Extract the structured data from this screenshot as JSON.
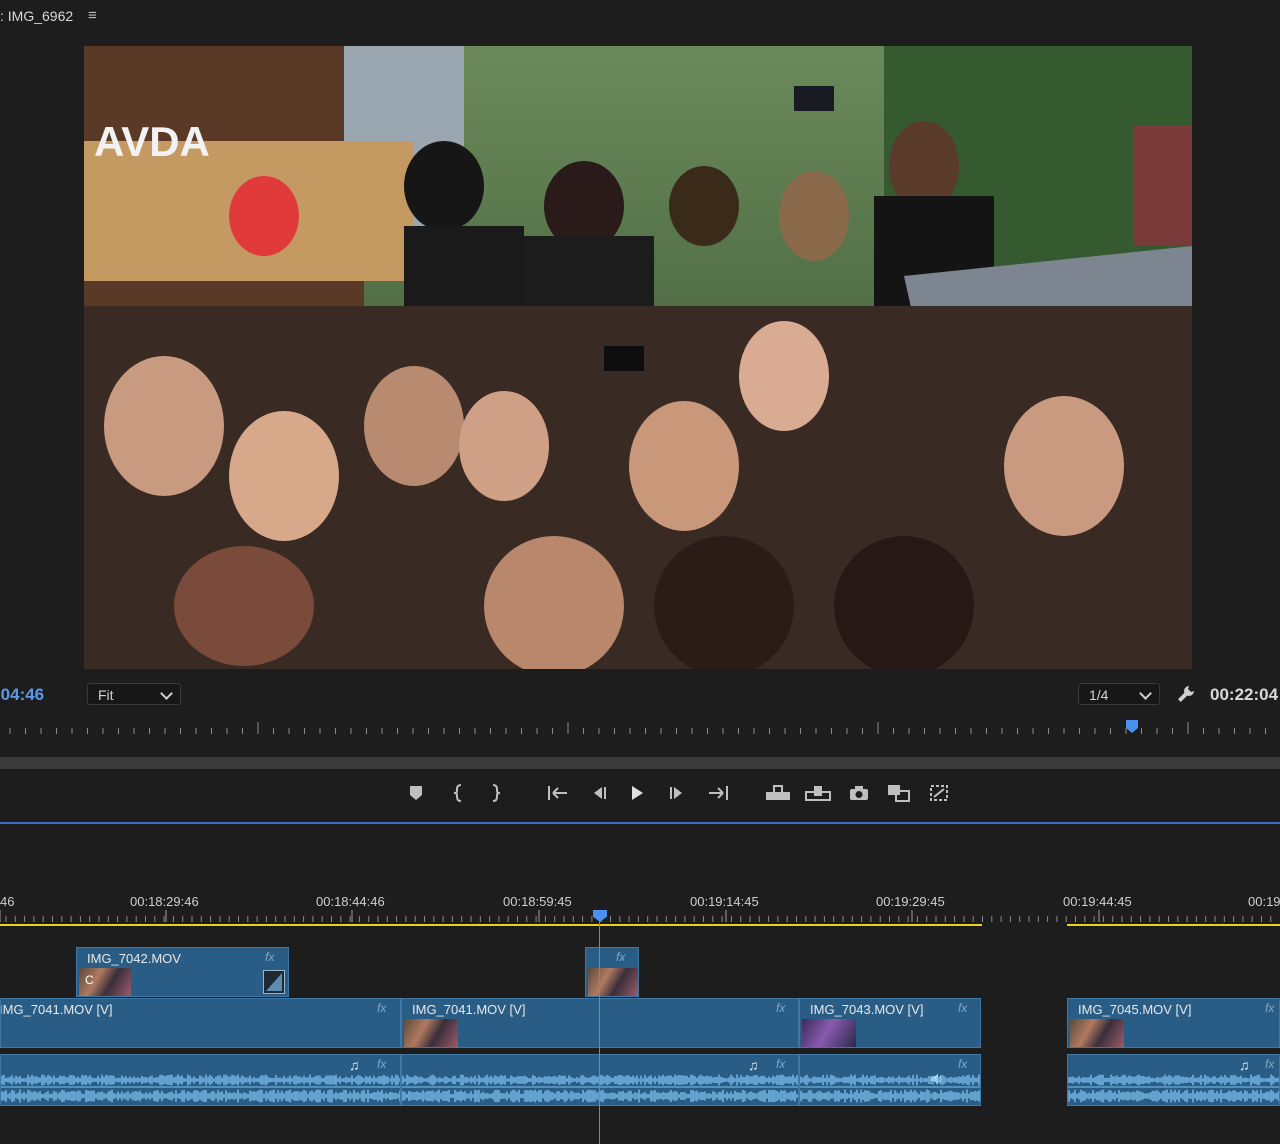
{
  "monitor": {
    "title": ": IMG_6962",
    "menu_icon": "hamburger-icon",
    "timecode_current": ":04:46",
    "zoom_value": "Fit",
    "resolution_value": "1/4",
    "timecode_duration": "00:22:04"
  },
  "transport_icons": [
    "add-marker-icon",
    "mark-in-icon",
    "mark-out-icon",
    "go-to-in-icon",
    "step-back-icon",
    "play-icon",
    "step-forward-icon",
    "go-to-out-icon",
    "insert-icon",
    "overwrite-icon",
    "export-frame-icon",
    "compare-view-icon",
    "toggle-proxies-icon"
  ],
  "timeline": {
    "ruler_labels": [
      "46",
      "00:18:29:46",
      "00:18:44:46",
      "00:18:59:45",
      "00:19:14:45",
      "00:19:29:45",
      "00:19:44:45",
      "00:19"
    ],
    "fx_label": "fx",
    "clip_v2_a": "IMG_7042.MOV",
    "clip_v2_a_thumb_label": "C",
    "clip_v1_a": "IMG_7041.MOV [V]",
    "clip_v1_b": "IMG_7041.MOV [V]",
    "clip_v1_c": "IMG_7043.MOV [V]",
    "clip_v1_d": "IMG_7045.MOV [V]",
    "audio_icon": "music-note-icon",
    "audio_note": "♫",
    "audio_voice_icon": "speaker-icon"
  },
  "colors": {
    "accent": "#4a90f0",
    "clip": "#2a5d86",
    "waveform": "#7cc1ee",
    "timecode": "#5b9ae8",
    "work_area": "#e8d21c"
  }
}
